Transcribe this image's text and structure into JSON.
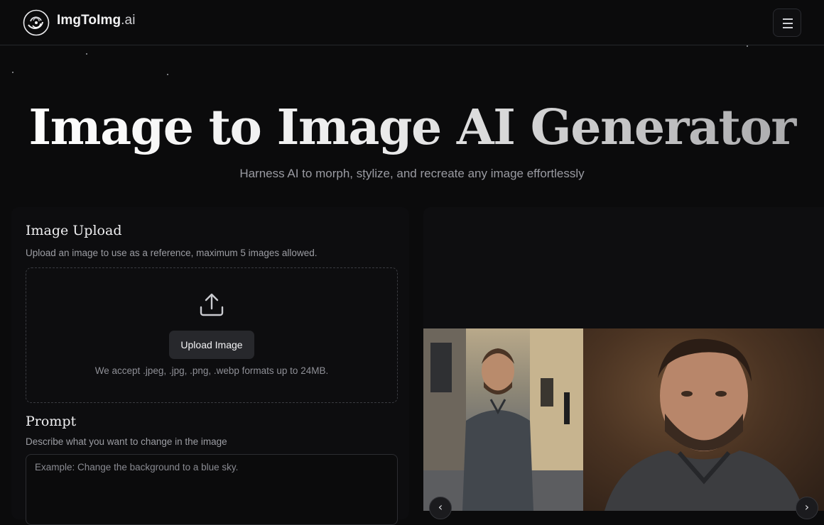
{
  "header": {
    "brand_main": "ImgToImg",
    "brand_suffix": ".ai",
    "logo_icon": "swirl-logo-icon",
    "menu_icon": "hamburger-menu-icon"
  },
  "hero": {
    "title": "Image to Image AI Generator",
    "subtitle": "Harness AI to morph, stylize, and recreate any image effortlessly"
  },
  "upload_section": {
    "title": "Image Upload",
    "description": "Upload an image to use as a reference, maximum 5 images allowed.",
    "upload_icon": "upload-arrow-icon",
    "button_label": "Upload Image",
    "accept_text": "We accept .jpeg, .jpg, .png, .webp formats up to 24MB."
  },
  "prompt_section": {
    "title": "Prompt",
    "description": "Describe what you want to change in the image",
    "placeholder": "Example: Change the background to a blue sky."
  },
  "preview": {
    "prev_icon": "chevron-left-icon",
    "next_icon": "chevron-right-icon",
    "prev_glyph": "‹",
    "next_glyph": "›"
  },
  "colors": {
    "background": "#0b0b0c",
    "panel": "#0d0d0f",
    "button": "#27282c",
    "muted_text": "#9c9da3"
  }
}
